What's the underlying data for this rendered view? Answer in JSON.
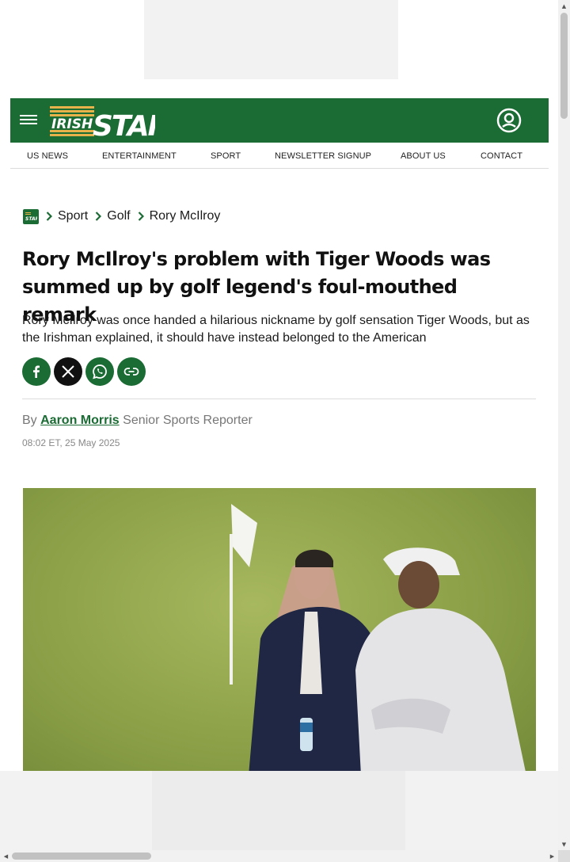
{
  "site": {
    "logo_text_irish": "IRISH",
    "logo_text_star": "STAR",
    "brand_color": "#1b6b34"
  },
  "nav": {
    "items": [
      "US NEWS",
      "ENTERTAINMENT",
      "SPORT",
      "NEWSLETTER SIGNUP",
      "ABOUT US",
      "CONTACT"
    ]
  },
  "breadcrumb": {
    "items": [
      "Sport",
      "Golf",
      "Rory McIlroy"
    ]
  },
  "article": {
    "headline": "Rory McIlroy's problem with Tiger Woods was summed up by golf legend's foul-mouthed remark",
    "standfirst": "Rory McIlroy was once handed a hilarious nickname by golf sensation Tiger Woods, but as the Irishman explained, it should have instead belonged to the American",
    "byline_prefix": "By",
    "author": "Aaron Morris",
    "author_role": "Senior Sports Reporter",
    "published": "08:02 ET, 25 May 2025"
  },
  "icons": {
    "menu": "hamburger-icon",
    "account": "user-circle-icon",
    "home": "home-logo-icon",
    "facebook": "facebook-icon",
    "x": "x-icon",
    "whatsapp": "whatsapp-icon",
    "link": "link-icon"
  }
}
